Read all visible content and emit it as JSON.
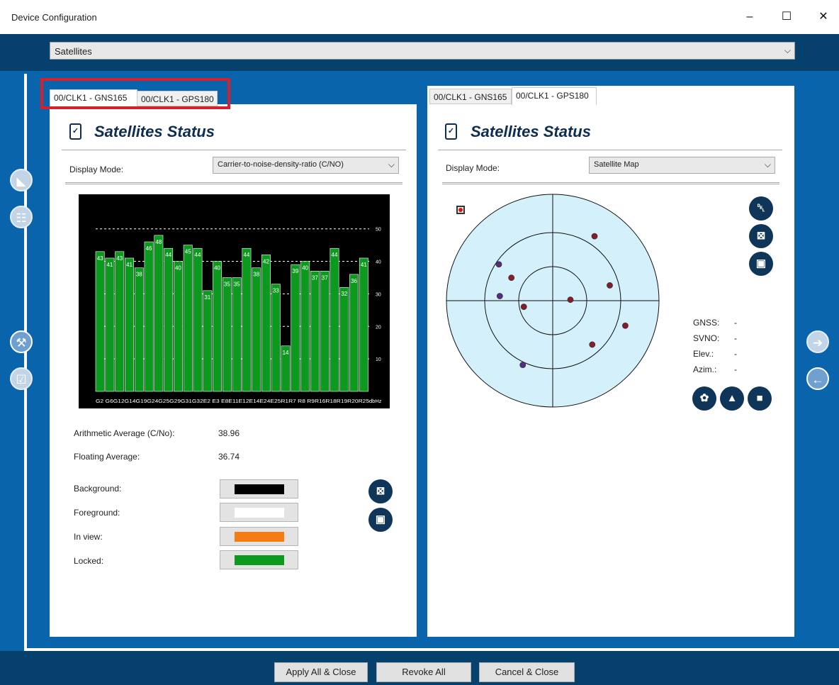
{
  "window": {
    "title": "Device Configuration",
    "minimize": "–",
    "maximize": "☐",
    "close": "✕"
  },
  "top_select": {
    "value": "Satellites",
    "chevron": "⌵"
  },
  "footer": {
    "apply": "Apply All & Close",
    "revoke": "Revoke All",
    "cancel": "Cancel & Close"
  },
  "left_panel": {
    "tabs": [
      "00/CLK1 - GNS165",
      "00/CLK1 - GPS180"
    ],
    "selected_tab": 0,
    "header": "Satellites Status",
    "display_mode_label": "Display Mode:",
    "display_mode_value": "Carrier-to-noise-density-ratio (C/NO)",
    "arith_label": "Arithmetic Average (C/No):",
    "arith_value": "38.96",
    "float_label": "Floating Average:",
    "float_value": "36.74",
    "colors": [
      {
        "label": "Background:",
        "color": "#000000"
      },
      {
        "label": "Foreground:",
        "color": "#ffffff"
      },
      {
        "label": "In view:",
        "color": "#f57c13"
      },
      {
        "label": "Locked:",
        "color": "#0b9a1e"
      }
    ]
  },
  "chart_data": {
    "type": "bar",
    "categories": [
      "G2",
      "G6",
      "G12",
      "G14",
      "G19",
      "G24",
      "G25",
      "G29",
      "G31",
      "G32",
      "E2",
      "E3",
      "E8",
      "E11",
      "E12",
      "E14",
      "E24",
      "E25",
      "R1",
      "R7",
      "R8",
      "R9",
      "R16",
      "R18",
      "R19",
      "R20",
      "R25"
    ],
    "x_tick_text": "G2 G6G12G14G19G24G25G29G31G32E2 E3 E8E11E12E14E24E25R1R7 R8 R9R16R18R19R20R25",
    "unit_label": "dbHz",
    "values": [
      43,
      41,
      43,
      41,
      38,
      46,
      48,
      44,
      40,
      45,
      44,
      31,
      40,
      35,
      35,
      44,
      38,
      42,
      33,
      14,
      39,
      40,
      37,
      37,
      44,
      32,
      36,
      41
    ],
    "yticks": [
      10,
      20,
      30,
      40,
      50
    ],
    "ylim": [
      0,
      58
    ],
    "background": "#000000",
    "bar_color": "#0b9a1e",
    "gridlines": "dashed white"
  },
  "right_panel": {
    "tabs": [
      "00/CLK1 - GNS165",
      "00/CLK1 - GPS180"
    ],
    "selected_tab": 1,
    "header": "Satellites Status",
    "display_mode_label": "Display Mode:",
    "display_mode_value": "Satellite Map",
    "info": [
      {
        "label": "GNSS:",
        "value": "-"
      },
      {
        "label": "SVNO:",
        "value": "-"
      },
      {
        "label": "Elev.:",
        "value": "-"
      },
      {
        "label": "Azim.:",
        "value": "-"
      }
    ],
    "satellites": [
      {
        "az": 304,
        "el": 35,
        "color": "#5a2b86"
      },
      {
        "az": 33,
        "el": 25,
        "color": "#8b1a2a"
      },
      {
        "az": 299,
        "el": 50,
        "color": "#8b1a2a"
      },
      {
        "az": 75,
        "el": 40,
        "color": "#8b1a2a"
      },
      {
        "az": 275,
        "el": 45,
        "color": "#5a2b86"
      },
      {
        "az": 87,
        "el": 75,
        "color": "#8b1a2a"
      },
      {
        "az": 258,
        "el": 65,
        "color": "#8b1a2a"
      },
      {
        "az": 109,
        "el": 25,
        "color": "#8b1a2a"
      },
      {
        "az": 138,
        "el": 40,
        "color": "#8b1a2a"
      },
      {
        "az": 205,
        "el": 30,
        "color": "#5a2b86"
      }
    ]
  }
}
